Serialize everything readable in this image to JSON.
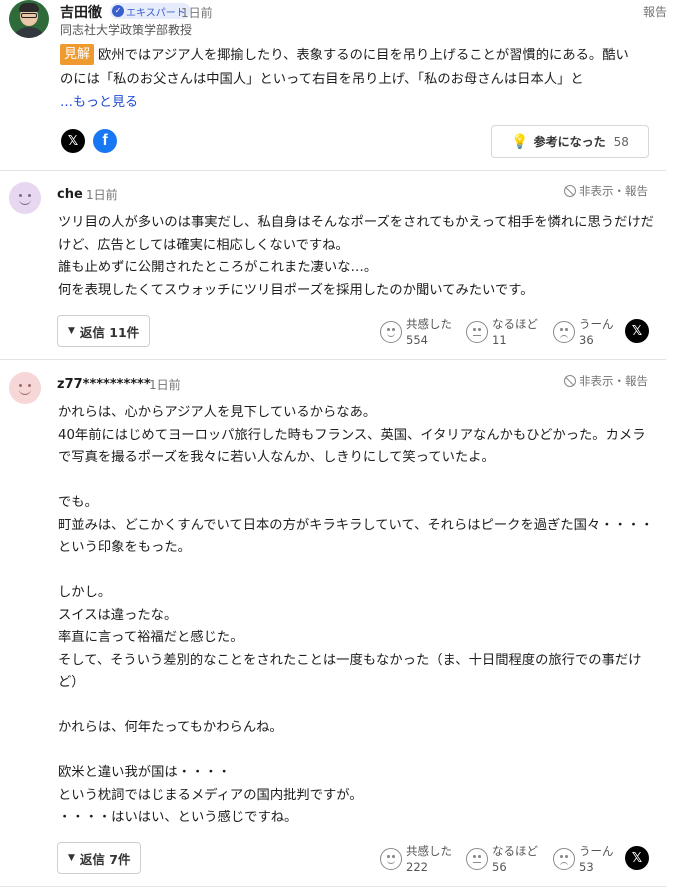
{
  "expert": {
    "name": "吉田徹",
    "badge": "エキスパート",
    "time": "1日前",
    "title": "同志社大学政策学部教授",
    "report": "報告",
    "tag": "見解",
    "body": "欧州ではアジア人を揶揄したり、表象するのに目を吊り上げることが習慣的にある。酷いのには「私のお父さんは中国人」といって右目を吊り上げ、「私のお母さんは日本人」と",
    "more": "…もっと見る",
    "helpful_label": "参考になった",
    "helpful_count": "58"
  },
  "comments": [
    {
      "user": "che",
      "time": "1日前",
      "hide_report": "非表示・報告",
      "avatar_color": "#e7d7f1",
      "body": "ツリ目の人が多いのは事実だし、私自身はそんなポーズをされてもかえって相手を憐れに思うだけだけど、広告としては確実に相応しくないですね。\n誰も止めずに公開されたところがこれまた凄いな…。\n何を表現したくてスウォッチにツリ目ポーズを採用したのか聞いてみたいです。",
      "reply_label": "返信 11件",
      "reactions": [
        {
          "label": "共感した",
          "count": "554"
        },
        {
          "label": "なるほど",
          "count": "11"
        },
        {
          "label": "うーん",
          "count": "36"
        }
      ]
    },
    {
      "user": "z77**********",
      "time": "1日前",
      "hide_report": "非表示・報告",
      "avatar_color": "#f6d6d6",
      "body": "かれらは、心からアジア人を見下しているからなあ。\n40年前にはじめてヨーロッパ旅行した時もフランス、英国、イタリアなんかもひどかった。カメラで写真を撮るポーズを我々に若い人なんか、しきりにして笑っていたよ。\n\nでも。\n町並みは、どこかくすんでいて日本の方がキラキラしていて、それらはピークを過ぎた国々・・・・という印象をもった。\n\nしかし。\nスイスは違ったな。\n率直に言って裕福だと感じた。\nそして、そういう差別的なことをされたことは一度もなかった（ま、十日間程度の旅行での事だけど）\n\nかれらは、何年たってもかわらんね。\n\n欧米と違い我が国は・・・・\nという枕詞ではじまるメディアの国内批判ですが。\n・・・・はいはい、という感じですね。",
      "reply_label": "返信 7件",
      "reactions": [
        {
          "label": "共感した",
          "count": "222"
        },
        {
          "label": "なるほど",
          "count": "56"
        },
        {
          "label": "うーん",
          "count": "53"
        }
      ]
    }
  ],
  "icons": {
    "x": "𝕏",
    "facebook": "f",
    "bulb": "💡"
  }
}
